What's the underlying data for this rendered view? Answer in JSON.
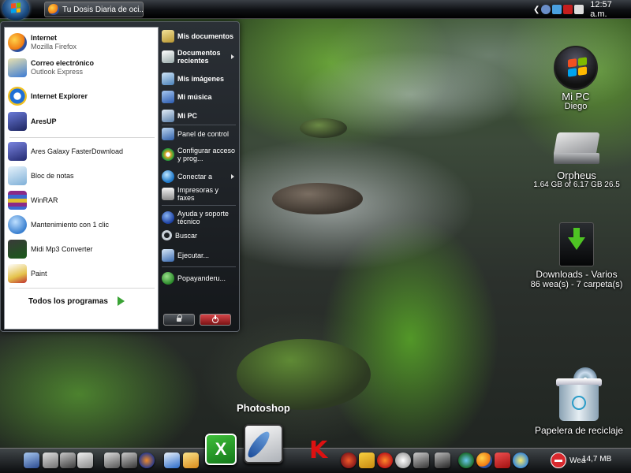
{
  "taskbar": {
    "start_button_name": "start-orb",
    "window_button": "Tu Dosis Diaria de oci...",
    "clock": "12:57 a.m."
  },
  "start_menu": {
    "pinned": [
      {
        "label": "Internet",
        "sub": "Mozilla Firefox",
        "icon": "firefox-icon",
        "color": "#f07a12"
      },
      {
        "label": "Correo electrónico",
        "sub": "Outlook Express",
        "icon": "outlook-express-icon",
        "color": "#3b7bd4"
      }
    ],
    "recent": [
      {
        "label": "Internet Explorer",
        "icon": "internet-explorer-icon",
        "color": "#1f6fd6"
      },
      {
        "label": "AresUP",
        "icon": "aresup-icon",
        "color": "#2d3a8c"
      },
      {
        "label": "Ares Galaxy FasterDownload",
        "icon": "ares-galaxy-icon",
        "color": "#3a3f99"
      },
      {
        "label": "Bloc de notas",
        "icon": "notepad-icon",
        "color": "#9cc8e8"
      },
      {
        "label": "WinRAR",
        "icon": "winrar-icon",
        "color": "#8b2a86"
      },
      {
        "label": "Mantenimiento con 1 clic",
        "icon": "maintenance-icon",
        "color": "#5aa0e0"
      },
      {
        "label": "Midi Mp3 Converter",
        "icon": "midi-converter-icon",
        "color": "#2a6a2a"
      },
      {
        "label": "Paint",
        "icon": "paint-icon",
        "color": "#e4c24a"
      }
    ],
    "all_programs": "Todos los programas",
    "right": [
      {
        "label": "Mis documentos",
        "icon": "my-documents-icon",
        "color": "#d8c46a",
        "bold": true
      },
      {
        "label": "Documentos recientes",
        "icon": "recent-documents-icon",
        "color": "#e0e0e0",
        "bold": true,
        "arrow": true
      },
      {
        "label": "Mis imágenes",
        "icon": "my-pictures-icon",
        "color": "#7ab0d8",
        "bold": true
      },
      {
        "label": "Mi música",
        "icon": "my-music-icon",
        "color": "#5c8fd0",
        "bold": true
      },
      {
        "label": "Mi PC",
        "icon": "my-pc-icon",
        "color": "#9ab8d8",
        "bold": true
      },
      {
        "label": "Panel de control",
        "icon": "control-panel-icon",
        "color": "#4b80c8"
      },
      {
        "label": "Configurar acceso y prog...",
        "icon": "set-program-access-icon",
        "color": "#e4a72a"
      },
      {
        "label": "Conectar a",
        "icon": "connect-to-icon",
        "color": "#3aa0d8",
        "arrow": true
      },
      {
        "label": "Impresoras y faxes",
        "icon": "printers-icon",
        "color": "#c8c8c8"
      },
      {
        "label": "Ayuda y soporte técnico",
        "icon": "help-icon",
        "color": "#2a5ec0"
      },
      {
        "label": "Buscar",
        "icon": "search-icon",
        "color": "#b0b8c0"
      },
      {
        "label": "Ejecutar...",
        "icon": "run-icon",
        "color": "#5a8ac8"
      },
      {
        "label": "Popayanderu...",
        "icon": "user-icon",
        "color": "#3aa335"
      }
    ]
  },
  "desktop": {
    "mi_pc": {
      "label": "Mi PC",
      "sub": "Diego"
    },
    "orpheus": {
      "label": "Orpheus",
      "sub": "1.64 GB of 6.17 GB 26.5"
    },
    "downloads": {
      "label": "Downloads - Varios",
      "sub": "86 wea(s) - 7 carpeta(s)"
    },
    "recycle": {
      "label": "Papelera de reciclaje"
    }
  },
  "dock": {
    "hover_label": "Photoshop",
    "weather_text": "Wea",
    "size_text": "14,7 MB",
    "excel_letter": "X",
    "kaspersky_letter": "K"
  },
  "colors": {
    "flag_red": "#f25022",
    "flag_green": "#7fba00",
    "flag_blue": "#00a4ef",
    "flag_yellow": "#ffb900"
  }
}
